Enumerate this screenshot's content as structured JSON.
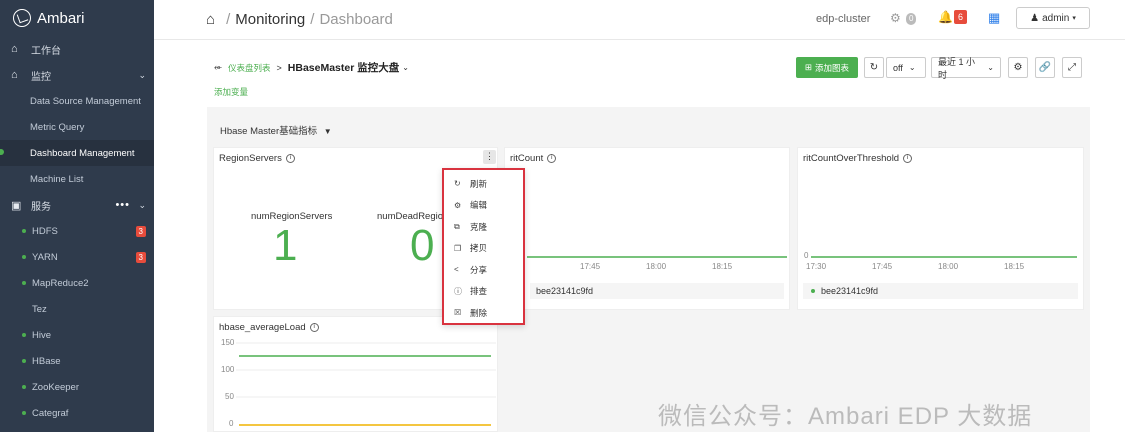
{
  "sidebar": {
    "brand": "Ambari",
    "workbench": "工作台",
    "monitor": "监控",
    "monitor_items": [
      "Data Source Management",
      "Metric Query",
      "Dashboard Management",
      "Machine List"
    ],
    "services_label": "服务",
    "services": [
      {
        "name": "HDFS",
        "badge": "3",
        "dot": true
      },
      {
        "name": "YARN",
        "badge": "3",
        "dot": true
      },
      {
        "name": "MapReduce2",
        "badge": "",
        "dot": true
      },
      {
        "name": "Tez",
        "badge": "",
        "dot": false
      },
      {
        "name": "Hive",
        "badge": "",
        "dot": true
      },
      {
        "name": "HBase",
        "badge": "",
        "dot": true
      },
      {
        "name": "ZooKeeper",
        "badge": "",
        "dot": true
      },
      {
        "name": "Categraf",
        "badge": "",
        "dot": true
      }
    ]
  },
  "topbar": {
    "crumb_1": "Monitoring",
    "crumb_2": "Dashboard",
    "cluster": "edp-cluster",
    "ops_count": "0",
    "alerts_count": "6",
    "user": "admin"
  },
  "dashboard": {
    "back_link": "仪表盘列表",
    "title": "HBaseMaster 监控大盘",
    "add_variable": "添加变量",
    "add_chart": "添加图表",
    "refresh_mode": "off",
    "time_range": "最近 1 小时",
    "group": "Hbase Master基础指标"
  },
  "panels": {
    "region_servers": {
      "title": "RegionServers",
      "stats": [
        {
          "label": "numRegionServers",
          "value": "1"
        },
        {
          "label": "numDeadRegionS",
          "value": "0"
        }
      ]
    },
    "rit_count": {
      "title": "ritCount",
      "x_ticks": [
        "17:45",
        "18:00",
        "18:15"
      ],
      "legend": "bee23141c9fd"
    },
    "rit_over_threshold": {
      "title": "ritCountOverThreshold",
      "y_tick": "0",
      "x_ticks": [
        "17:30",
        "17:45",
        "18:00",
        "18:15"
      ],
      "legend": "bee23141c9fd"
    },
    "average_load": {
      "title": "hbase_averageLoad",
      "y_ticks": [
        "150",
        "100",
        "50",
        "0"
      ]
    }
  },
  "context_menu": [
    {
      "label": "刷新",
      "icon": "refresh-icon"
    },
    {
      "label": "编辑",
      "icon": "gear-icon"
    },
    {
      "label": "克隆",
      "icon": "clone-icon"
    },
    {
      "label": "拷贝",
      "icon": "copy-icon"
    },
    {
      "label": "分享",
      "icon": "share-icon"
    },
    {
      "label": "排查",
      "icon": "info-icon"
    },
    {
      "label": "删除",
      "icon": "trash-icon"
    }
  ],
  "watermark": "微信公众号：Ambari EDP 大数据"
}
